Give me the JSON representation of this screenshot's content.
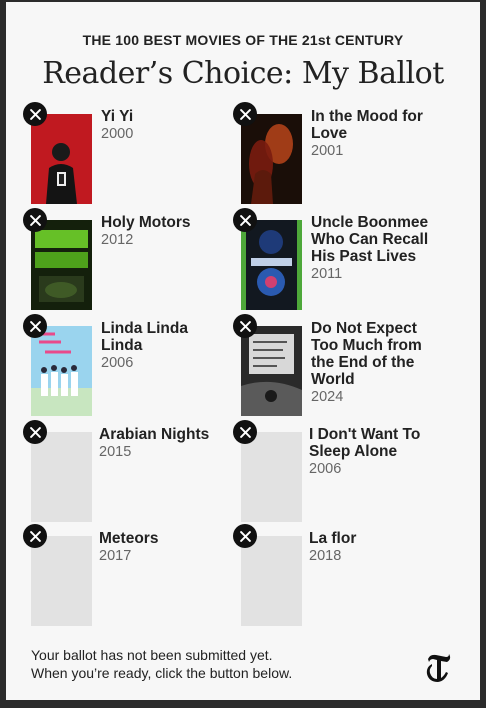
{
  "header": {
    "kicker": "THE 100 BEST MOVIES OF THE 21st CENTURY",
    "title": "Reader’s Choice: My Ballot"
  },
  "ballot": [
    {
      "title": "Yi Yi",
      "year": "2000",
      "poster": "yi-yi",
      "remove_icon": "close-icon"
    },
    {
      "title": "In the Mood for Love",
      "year": "2001",
      "poster": "in-the-mood-for-love",
      "remove_icon": "close-icon"
    },
    {
      "title": "Holy Motors",
      "year": "2012",
      "poster": "holy-motors",
      "remove_icon": "close-icon"
    },
    {
      "title": "Uncle Boonmee Who Can Recall His Past Lives",
      "year": "2011",
      "poster": "uncle-boonmee",
      "remove_icon": "close-icon"
    },
    {
      "title": "Linda Linda Linda",
      "year": "2006",
      "poster": "linda-linda-linda",
      "remove_icon": "close-icon"
    },
    {
      "title": "Do Not Expect Too Much from the End of the World",
      "year": "2024",
      "poster": "do-not-expect",
      "remove_icon": "close-icon"
    },
    {
      "title": "Arabian Nights",
      "year": "2015",
      "poster": "placeholder",
      "remove_icon": "close-icon"
    },
    {
      "title": "I Don't Want To Sleep Alone",
      "year": "2006",
      "poster": "placeholder",
      "remove_icon": "close-icon"
    },
    {
      "title": "Meteors",
      "year": "2017",
      "poster": "placeholder",
      "remove_icon": "close-icon"
    },
    {
      "title": "La flor",
      "year": "2018",
      "poster": "placeholder",
      "remove_icon": "close-icon"
    }
  ],
  "footer": {
    "line1": "Your ballot has not been submitted yet.",
    "line2": "When you’re ready, click the button below."
  },
  "logo": "nyt-t-logo"
}
